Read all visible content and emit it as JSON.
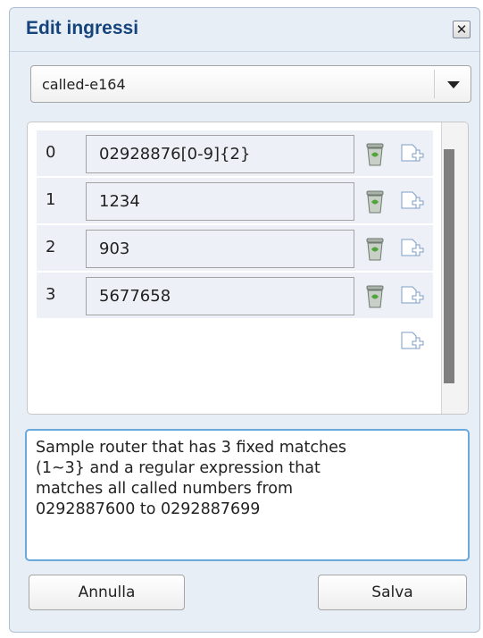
{
  "dialog": {
    "title": "Edit ingressi",
    "close_label": "✕"
  },
  "select": {
    "value": "called-e164"
  },
  "rows": [
    {
      "index": "0",
      "value": "02928876[0-9]{2}"
    },
    {
      "index": "1",
      "value": "1234"
    },
    {
      "index": "2",
      "value": "903"
    },
    {
      "index": "3",
      "value": "5677658"
    }
  ],
  "notes": {
    "text": "Sample router that has 3 fixed matches\n(1~3} and a regular expression that\nmatches all called numbers from\n0292887600 to 0292887699"
  },
  "buttons": {
    "cancel": "Annulla",
    "save": "Salva"
  },
  "icons": {
    "delete": "trash-icon",
    "add": "add-row-icon"
  },
  "colors": {
    "title": "#15447d",
    "dialog_bg": "#e7eef6",
    "row_bg": "#edf1f7",
    "focus_border": "#6aa9db"
  }
}
